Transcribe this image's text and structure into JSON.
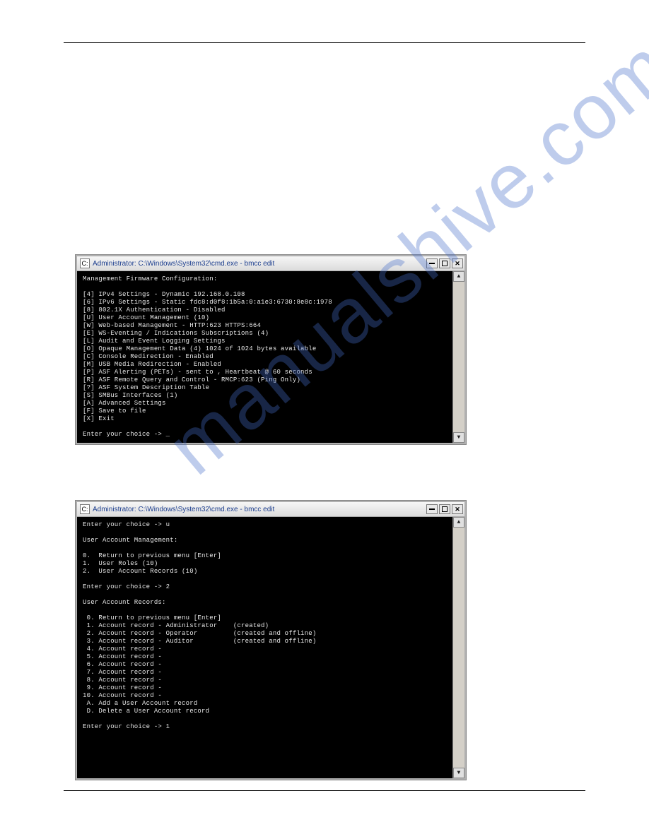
{
  "watermark": "manualshive.com",
  "window": {
    "title": "Administrator: C:\\Windows\\System32\\cmd.exe - bmcc  edit",
    "icon_label": "cmd-icon"
  },
  "term1": {
    "heading": "Management Firmware Configuration:",
    "lines": [
      "[4] IPv4 Settings - Dynamic 192.168.0.108",
      "[6] IPv6 Settings - Static fdc8:d0f8:1b5a:0:a1e3:6730:8e8c:1978",
      "[8] 802.1X Authentication - Disabled",
      "[U] User Account Management (10)",
      "[W] Web-based Management - HTTP:623 HTTPS:664",
      "[E] WS-Eventing / Indications Subscriptions (4)",
      "[L] Audit and Event Logging Settings",
      "[O] Opaque Management Data (4) 1024 of 1024 bytes available",
      "[C] Console Redirection - Enabled",
      "[M] USB Media Redirection - Enabled",
      "[P] ASF Alerting (PETs) - sent to , Heartbeat @ 60 seconds",
      "[R] ASF Remote Query and Control - RMCP:623 (Ping Only)",
      "[?] ASF System Description Table",
      "[S] SMBus Interfaces (1)",
      "[A] Advanced Settings",
      "[F] Save to file",
      "[X] Exit"
    ],
    "prompt": "Enter your choice -> _"
  },
  "term2": {
    "prompt1": "Enter your choice -> u",
    "heading1": "User Account Management:",
    "menu1": [
      "0.  Return to previous menu [Enter]",
      "1.  User Roles (10)",
      "2.  User Account Records (10)"
    ],
    "prompt2": "Enter your choice -> 2",
    "heading2": "User Account Records:",
    "menu2": [
      " 0. Return to previous menu [Enter]",
      " 1. Account record - Administrator    (created)",
      " 2. Account record - Operator         (created and offline)",
      " 3. Account record - Auditor          (created and offline)",
      " 4. Account record -",
      " 5. Account record -",
      " 6. Account record -",
      " 7. Account record -",
      " 8. Account record -",
      " 9. Account record -",
      "10. Account record -",
      " A. Add a User Account record",
      " D. Delete a User Account record"
    ],
    "prompt3": "Enter your choice -> 1"
  }
}
